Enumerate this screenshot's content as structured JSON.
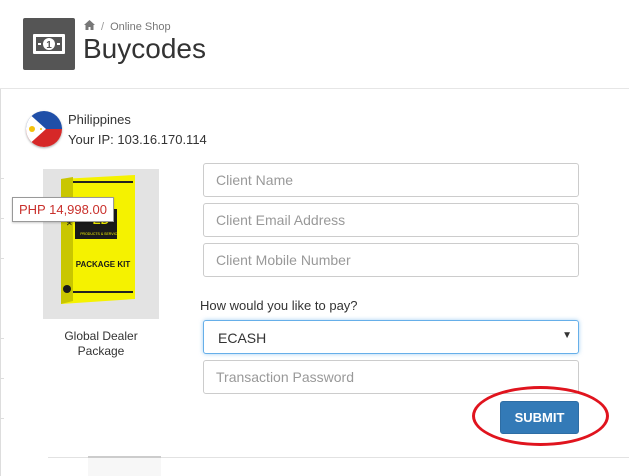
{
  "header": {
    "breadcrumb": {
      "home_icon": "home-icon",
      "separator": "/",
      "current": "Online Shop"
    },
    "title": "Buycodes",
    "icon": "money-bill-icon"
  },
  "location": {
    "country": "Philippines",
    "ip_text": "Your IP: 103.16.170.114",
    "flag_icon": "philippines-flag-icon"
  },
  "product": {
    "price": "PHP 14,998.00",
    "name_line1": "Global Dealer",
    "name_line2": "Package",
    "box_labels": {
      "tag": "ED",
      "subtitle": "PRODUCTS & SERVICES",
      "kit": "PACKAGE KIT",
      "side": "PACK"
    }
  },
  "form": {
    "client_name_placeholder": "Client Name",
    "client_email_placeholder": "Client Email Address",
    "client_mobile_placeholder": "Client Mobile Number",
    "pay_question": "How would you like to pay?",
    "payment_method": "ECASH",
    "transaction_password_placeholder": "Transaction Password",
    "submit_label": "SUBMIT"
  },
  "colors": {
    "primary_button": "#337ab7",
    "price_text": "#c9302c",
    "highlight_circle": "#e0141e",
    "header_icon_bg": "#555555",
    "product_box": "#f5f200"
  }
}
